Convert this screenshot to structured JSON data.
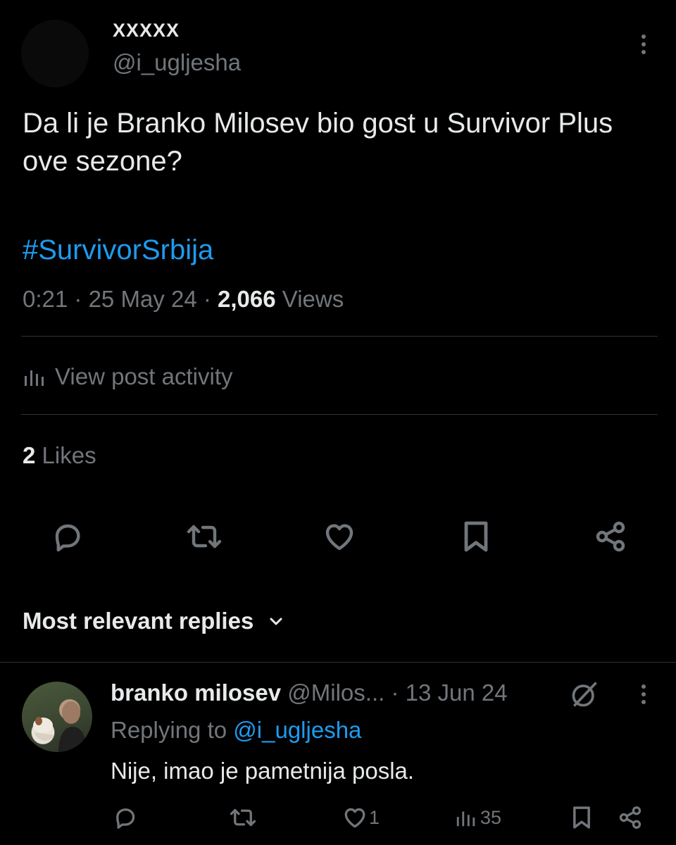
{
  "post": {
    "author_name": "XXXXX",
    "author_handle": "@i_ugljesha",
    "text": "Da li je Branko Milosev bio gost u Survivor Plus ove sezone?",
    "hashtag": "#SurvivorSrbija",
    "time": "0:21",
    "date": "25 May 24",
    "views_count": "2,066",
    "views_label": "Views",
    "activity_label": "View post activity",
    "likes_count": "2",
    "likes_label": "Likes",
    "sep": "·"
  },
  "actions": {
    "icons": [
      "reply-icon",
      "retweet-icon",
      "like-icon",
      "bookmark-icon",
      "share-icon"
    ]
  },
  "replies": {
    "sort_label": "Most relevant replies",
    "items": [
      {
        "name": "branko milosev",
        "handle": "@Milos...",
        "date": "13 Jun 24",
        "replying_prefix": "Replying to",
        "replying_handle": "@i_ugljesha",
        "text": "Nije, imao je pametnija posla.",
        "likes": "1",
        "views": "35"
      }
    ]
  },
  "colors": {
    "background": "#000000",
    "text": "#e7e9ea",
    "muted": "#71767b",
    "accent": "#1d9bf0",
    "divider": "#2f3336"
  }
}
